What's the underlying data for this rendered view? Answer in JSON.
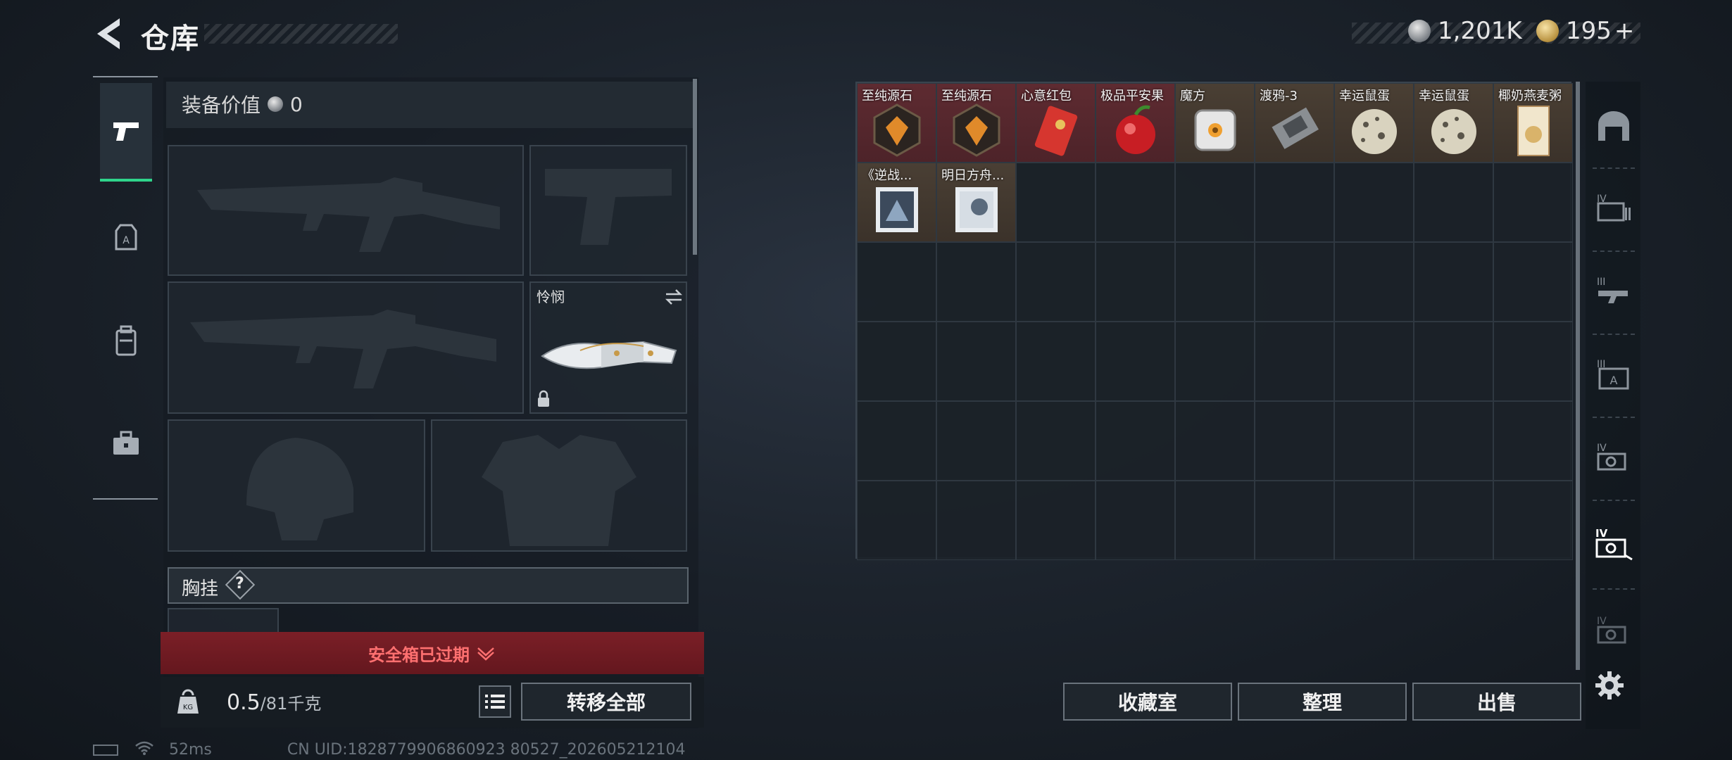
{
  "header": {
    "title": "仓库"
  },
  "currency": {
    "silver": "1,201K",
    "gold": "195",
    "gold_plus": "+"
  },
  "loadout": {
    "equip_value_label": "装备价值",
    "equip_value": "0",
    "melee_name": "怜悯",
    "chest_rig_label": "胸挂",
    "chest_rig_help": "?",
    "safe_box_status": "安全箱已过期",
    "weight_current": "0.5",
    "weight_max": "/81千克",
    "transfer_all": "转移全部"
  },
  "inventory": {
    "items": [
      {
        "name": "至纯源石"
      },
      {
        "name": "至纯源石"
      },
      {
        "name": "心意红包"
      },
      {
        "name": "极品平安果"
      },
      {
        "name": "魔方"
      },
      {
        "name": "渡鸦-3"
      },
      {
        "name": "幸运鼠蛋"
      },
      {
        "name": "幸运鼠蛋"
      },
      {
        "name": "椰奶燕麦粥"
      },
      {
        "name": "《逆战..."
      },
      {
        "name": "明日方舟..."
      }
    ],
    "buttons": {
      "collection": "收藏室",
      "sort": "整理",
      "sell": "出售"
    }
  },
  "right_tabs": [
    "home-tab-icon",
    "storage-iv-tab-icon",
    "storage-iii-tab-icon",
    "storage-iii-alt-tab-icon",
    "storage-iv-b-tab-icon",
    "storage-iv-active-tab-icon",
    "storage-iv-c-tab-icon"
  ],
  "footer": {
    "ping": "52ms",
    "uid": "CN UID:1828779906860923 80527_202605212104"
  },
  "colors": {
    "accent_green": "#2fd48b",
    "expired_red": "#7b1f27",
    "rare_red": "#5e2b31"
  }
}
